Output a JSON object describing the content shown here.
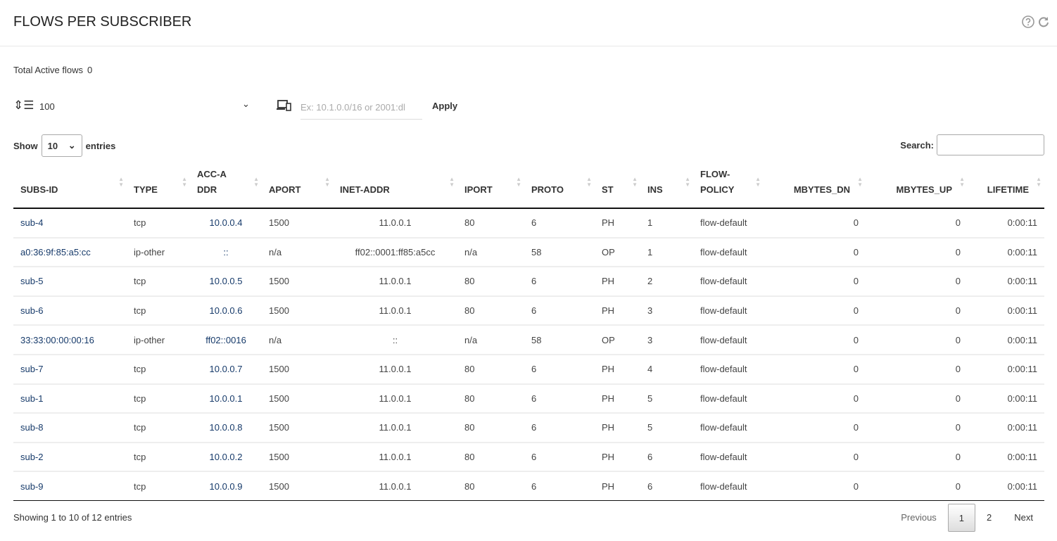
{
  "header": {
    "title": "FLOWS PER SUBSCRIBER",
    "icons": [
      "help-icon",
      "refresh-icon"
    ]
  },
  "summary": {
    "label": "Total Active flows",
    "value": "0"
  },
  "controls": {
    "limit_value": "100",
    "filter_placeholder": "Ex: 10.1.0.0/16 or 2001:dl",
    "apply_label": "Apply"
  },
  "length": {
    "show": "Show",
    "value": "10",
    "entries": "entries"
  },
  "search": {
    "label": "Search:",
    "value": ""
  },
  "table": {
    "columns": [
      "SUBS-ID",
      "TYPE",
      "ACC-ADDR",
      "APORT",
      "INET-ADDR",
      "IPORT",
      "PROTO",
      "ST",
      "INS",
      "FLOW-POLICY",
      "MBYTES_DN",
      "MBYTES_UP",
      "LIFETIME"
    ],
    "rows": [
      [
        "sub-4",
        "tcp",
        "10.0.0.4",
        "1500",
        "11.0.0.1",
        "80",
        "6",
        "PH",
        "1",
        "flow-default",
        "0",
        "0",
        "0:00:11"
      ],
      [
        "a0:36:9f:85:a5:cc",
        "ip-other",
        "::",
        "n/a",
        "ff02::0001:ff85:a5cc",
        "n/a",
        "58",
        "OP",
        "1",
        "flow-default",
        "0",
        "0",
        "0:00:11"
      ],
      [
        "sub-5",
        "tcp",
        "10.0.0.5",
        "1500",
        "11.0.0.1",
        "80",
        "6",
        "PH",
        "2",
        "flow-default",
        "0",
        "0",
        "0:00:11"
      ],
      [
        "sub-6",
        "tcp",
        "10.0.0.6",
        "1500",
        "11.0.0.1",
        "80",
        "6",
        "PH",
        "3",
        "flow-default",
        "0",
        "0",
        "0:00:11"
      ],
      [
        "33:33:00:00:00:16",
        "ip-other",
        "ff02::0016",
        "n/a",
        "::",
        "n/a",
        "58",
        "OP",
        "3",
        "flow-default",
        "0",
        "0",
        "0:00:11"
      ],
      [
        "sub-7",
        "tcp",
        "10.0.0.7",
        "1500",
        "11.0.0.1",
        "80",
        "6",
        "PH",
        "4",
        "flow-default",
        "0",
        "0",
        "0:00:11"
      ],
      [
        "sub-1",
        "tcp",
        "10.0.0.1",
        "1500",
        "11.0.0.1",
        "80",
        "6",
        "PH",
        "5",
        "flow-default",
        "0",
        "0",
        "0:00:11"
      ],
      [
        "sub-8",
        "tcp",
        "10.0.0.8",
        "1500",
        "11.0.0.1",
        "80",
        "6",
        "PH",
        "5",
        "flow-default",
        "0",
        "0",
        "0:00:11"
      ],
      [
        "sub-2",
        "tcp",
        "10.0.0.2",
        "1500",
        "11.0.0.1",
        "80",
        "6",
        "PH",
        "6",
        "flow-default",
        "0",
        "0",
        "0:00:11"
      ],
      [
        "sub-9",
        "tcp",
        "10.0.0.9",
        "1500",
        "11.0.0.1",
        "80",
        "6",
        "PH",
        "6",
        "flow-default",
        "0",
        "0",
        "0:00:11"
      ]
    ]
  },
  "footer": {
    "info": "Showing 1 to 10 of 12 entries",
    "previous": "Previous",
    "pages": [
      "1",
      "2"
    ],
    "next": "Next"
  }
}
